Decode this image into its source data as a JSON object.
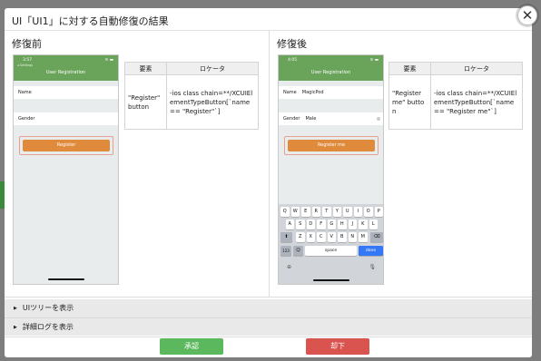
{
  "modal": {
    "title": "UI「UI1」に対する自動修復の結果",
    "close_symbol": "✕"
  },
  "before": {
    "heading": "修復前",
    "phone": {
      "status_time": "3:57",
      "back_label": "◂ Settings",
      "nav_title": "User Registration",
      "name_label": "Name",
      "gender_label": "Gender",
      "register_label": "Register"
    },
    "table": {
      "headers": [
        "要素",
        "ロケータ"
      ],
      "element": "\"Register\" button",
      "locator": "-ios class chain=**/XCUIElementTypeButton[`name == \"Register\"`]"
    }
  },
  "after": {
    "heading": "修復後",
    "phone": {
      "status_time": "4:05",
      "nav_title": "User Registration",
      "name_label": "Name",
      "name_value": "MagicPod",
      "gender_label": "Gender",
      "gender_value": "Male",
      "register_label": "Register me",
      "keyboard": {
        "row1": [
          "Q",
          "W",
          "E",
          "R",
          "T",
          "Y",
          "U",
          "I",
          "O",
          "P"
        ],
        "row2": [
          "A",
          "S",
          "D",
          "F",
          "G",
          "H",
          "J",
          "K",
          "L"
        ],
        "row3": [
          "Z",
          "X",
          "C",
          "V",
          "B",
          "N",
          "M"
        ],
        "num_key": "123",
        "space_key": "space",
        "done_key": "done"
      }
    },
    "table": {
      "headers": [
        "要素",
        "ロケータ"
      ],
      "element": "\"Register me\" button",
      "locator": "-ios class chain=**/XCUIElementTypeButton[`name == \"Register me\"`]"
    }
  },
  "expanders": {
    "tree_label": "UIツリーを表示",
    "log_label": "詳細ログを表示"
  },
  "actions": {
    "approve_label": "承認",
    "reject_label": "却下"
  },
  "colors": {
    "approve": "#5cb85c",
    "reject": "#d9534f",
    "nav_green": "#6aa35a",
    "register_orange": "#e08a3c"
  }
}
